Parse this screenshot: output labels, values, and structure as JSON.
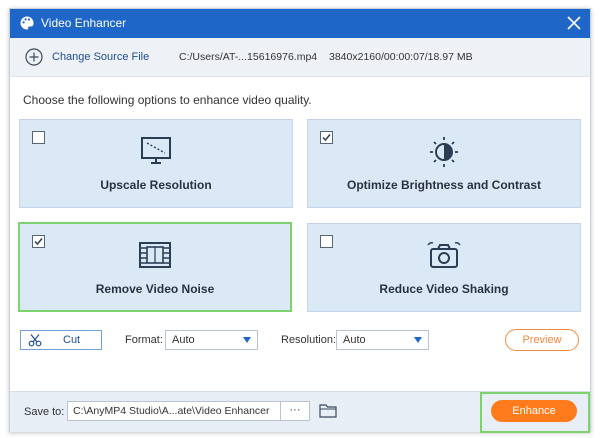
{
  "window": {
    "title": "Video Enhancer"
  },
  "source": {
    "change_label": "Change Source File",
    "path": "C:/Users/AT-...15616976.mp4",
    "meta": "3840x2160/00:00:07/18.97 MB"
  },
  "prompt": "Choose the following options to enhance video quality.",
  "options": [
    {
      "label": "Upscale Resolution",
      "checked": false,
      "icon": "monitor-icon"
    },
    {
      "label": "Optimize Brightness and Contrast",
      "checked": true,
      "icon": "brightness-icon"
    },
    {
      "label": "Remove Video Noise",
      "checked": true,
      "icon": "film-icon"
    },
    {
      "label": "Reduce Video Shaking",
      "checked": false,
      "icon": "camera-shake-icon"
    }
  ],
  "controls": {
    "cut_label": "Cut",
    "format_label": "Format:",
    "format_value": "Auto",
    "resolution_label": "Resolution:",
    "resolution_value": "Auto",
    "preview_label": "Preview"
  },
  "footer": {
    "save_label": "Save to:",
    "save_path": "C:\\AnyMP4 Studio\\A...ate\\Video Enhancer",
    "browse_label": "···",
    "enhance_label": "Enhance"
  },
  "colors": {
    "titlebar": "#1f66c9",
    "accent_orange": "#ff7b1c",
    "card_bg": "#dbe8f6",
    "highlight_green": "#7ed16f"
  }
}
